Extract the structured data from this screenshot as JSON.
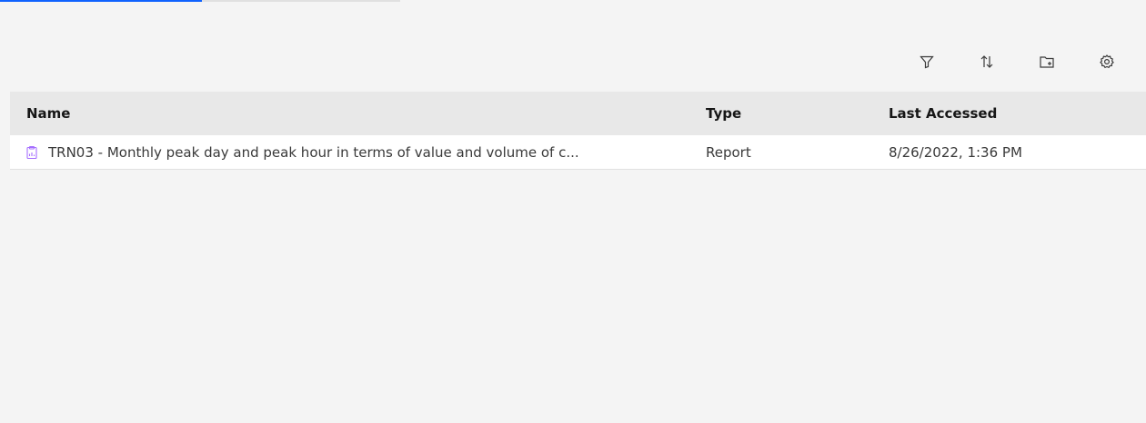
{
  "toolbar": {
    "icons": [
      "filter-icon",
      "sort-icon",
      "new-folder-icon",
      "settings-icon"
    ]
  },
  "table": {
    "columns": {
      "name": "Name",
      "type": "Type",
      "last_accessed": "Last Accessed"
    },
    "rows": [
      {
        "icon": "report-icon",
        "name": "TRN03 - Monthly peak day and peak hour in terms of value and volume of c...",
        "type": "Report",
        "last_accessed": "8/26/2022, 1:36 PM"
      }
    ]
  },
  "colors": {
    "accent": "#0f62fe",
    "report_icon": "#a56eff",
    "background": "#f4f4f4",
    "header_bg": "#e8e8e8"
  }
}
